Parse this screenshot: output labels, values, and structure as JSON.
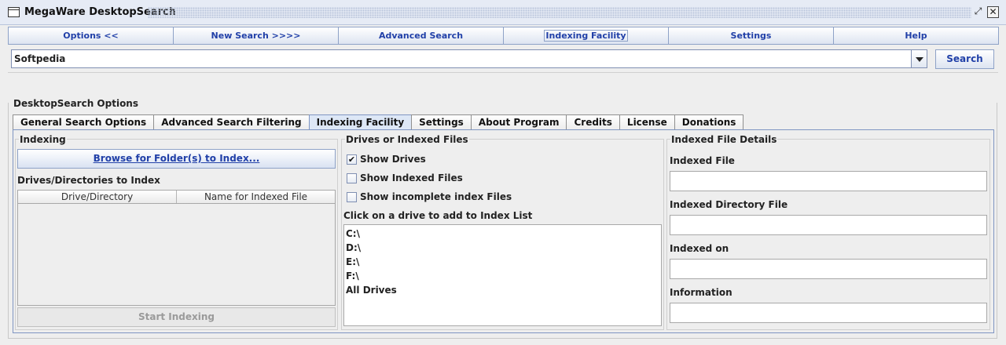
{
  "window": {
    "title": "MegaWare DesktopSearch"
  },
  "nav": {
    "buttons": [
      "Options <<",
      "New Search >>>>",
      "Advanced Search",
      "Indexing Facility",
      "Settings",
      "Help"
    ],
    "active_index": 3
  },
  "search": {
    "value": "Softpedia",
    "button_label": "Search"
  },
  "options": {
    "group_title": "DesktopSearch Options",
    "tabs": [
      "General Search Options",
      "Advanced Search Filtering",
      "Indexing Facility",
      "Settings",
      "About Program",
      "Credits",
      "License",
      "Donations"
    ],
    "active_tab": "Indexing Facility"
  },
  "indexing": {
    "title": "Indexing",
    "browse_button": "Browse for Folder(s) to Index...",
    "dirs_label": "Drives/Directories to Index",
    "columns": [
      "Drive/Directory",
      "Name for Indexed File"
    ],
    "start_button": "Start Indexing"
  },
  "drives": {
    "title": "Drives or Indexed Files",
    "checkboxes": [
      {
        "label": "Show Drives",
        "checked": true
      },
      {
        "label": "Show Indexed Files",
        "checked": false
      },
      {
        "label": "Show incomplete index Files",
        "checked": false
      }
    ],
    "list_label": "Click on a drive to add to Index List",
    "items": [
      "C:\\",
      "D:\\",
      "E:\\",
      "F:\\",
      "All Drives"
    ]
  },
  "details": {
    "title": "Indexed File Details",
    "fields": [
      {
        "label": "Indexed File",
        "value": ""
      },
      {
        "label": "Indexed Directory File",
        "value": ""
      },
      {
        "label": "Indexed on",
        "value": ""
      },
      {
        "label": "Information",
        "value": ""
      }
    ]
  },
  "icons": {
    "app": "window-app-icon",
    "restore": "restore-icon",
    "close": "close-icon",
    "dropdown": "chevron-down-icon",
    "check": "checkmark-icon"
  },
  "colors": {
    "accent_text": "#2140a8",
    "tab_active": "#dde7f6",
    "border_blue": "#7f95c2"
  }
}
